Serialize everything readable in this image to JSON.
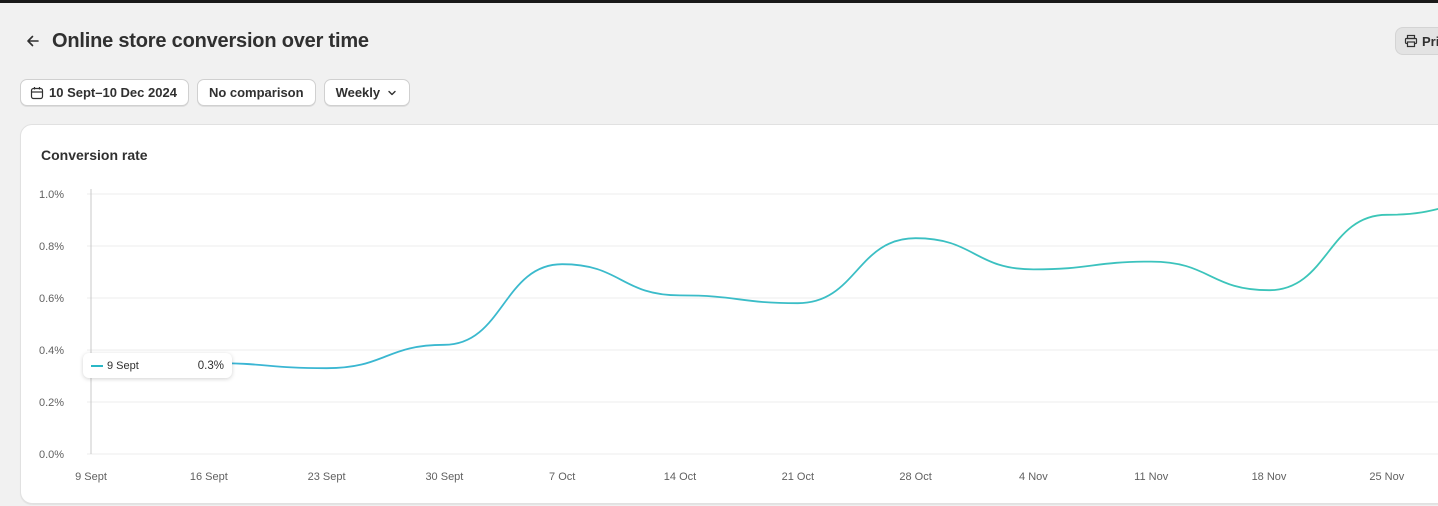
{
  "header": {
    "title": "Online store conversion over time",
    "print_label": "Print"
  },
  "filters": {
    "date_range": "10 Sept–10 Dec 2024",
    "comparison": "No comparison",
    "interval": "Weekly"
  },
  "card": {
    "title": "Conversion rate"
  },
  "tooltip": {
    "label": "9 Sept",
    "value": "0.3%"
  },
  "colors": {
    "line_start": "#3ab3d8",
    "line_end": "#3cc8b4",
    "gridline": "#ececec",
    "background": "#f1f1f1"
  },
  "chart_data": {
    "type": "line",
    "title": "Conversion rate",
    "xlabel": "",
    "ylabel": "",
    "ylim": [
      0,
      1.0
    ],
    "y_ticks": [
      "1.0%",
      "0.8%",
      "0.6%",
      "0.4%",
      "0.2%",
      "0.0%"
    ],
    "y_tick_values": [
      1.0,
      0.8,
      0.6,
      0.4,
      0.2,
      0.0
    ],
    "categories": [
      "9 Sept",
      "16 Sept",
      "23 Sept",
      "30 Sept",
      "7 Oct",
      "14 Oct",
      "21 Oct",
      "28 Oct",
      "4 Nov",
      "11 Nov",
      "18 Nov",
      "25 Nov"
    ],
    "grid": true,
    "series": [
      {
        "values": [
          0.35,
          0.35,
          0.33,
          0.42,
          0.73,
          0.61,
          0.58,
          0.83,
          0.71,
          0.74,
          0.63,
          0.92,
          0.98
        ]
      }
    ]
  }
}
